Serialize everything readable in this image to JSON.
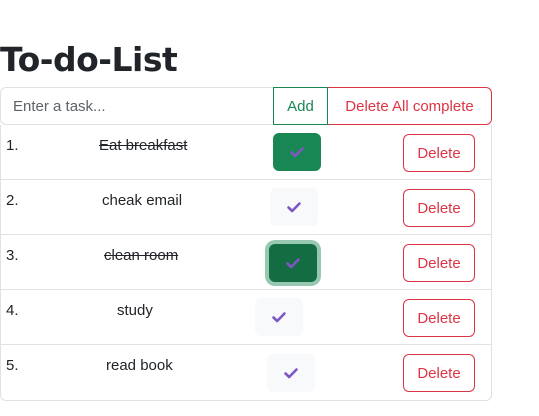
{
  "title": "To-do-List",
  "input": {
    "placeholder": "Enter a task..."
  },
  "buttons": {
    "add": "Add",
    "delete_all_complete": "Delete All complete"
  },
  "tasks": [
    {
      "num": "1.",
      "text": "Eat breakfast",
      "completed": true,
      "delete_label": "Delete"
    },
    {
      "num": "2.",
      "text": "cheak email",
      "completed": false,
      "delete_label": "Delete"
    },
    {
      "num": "3.",
      "text": "clean room",
      "completed": true,
      "delete_label": "Delete"
    },
    {
      "num": "4.",
      "text": "study",
      "completed": false,
      "delete_label": "Delete"
    },
    {
      "num": "5.",
      "text": "read book",
      "completed": false,
      "delete_label": "Delete"
    }
  ],
  "colors": {
    "success": "#198754",
    "danger": "#dc3545",
    "check_icon": "#7e57c2"
  },
  "icons": {
    "check": "checkmark-icon"
  }
}
